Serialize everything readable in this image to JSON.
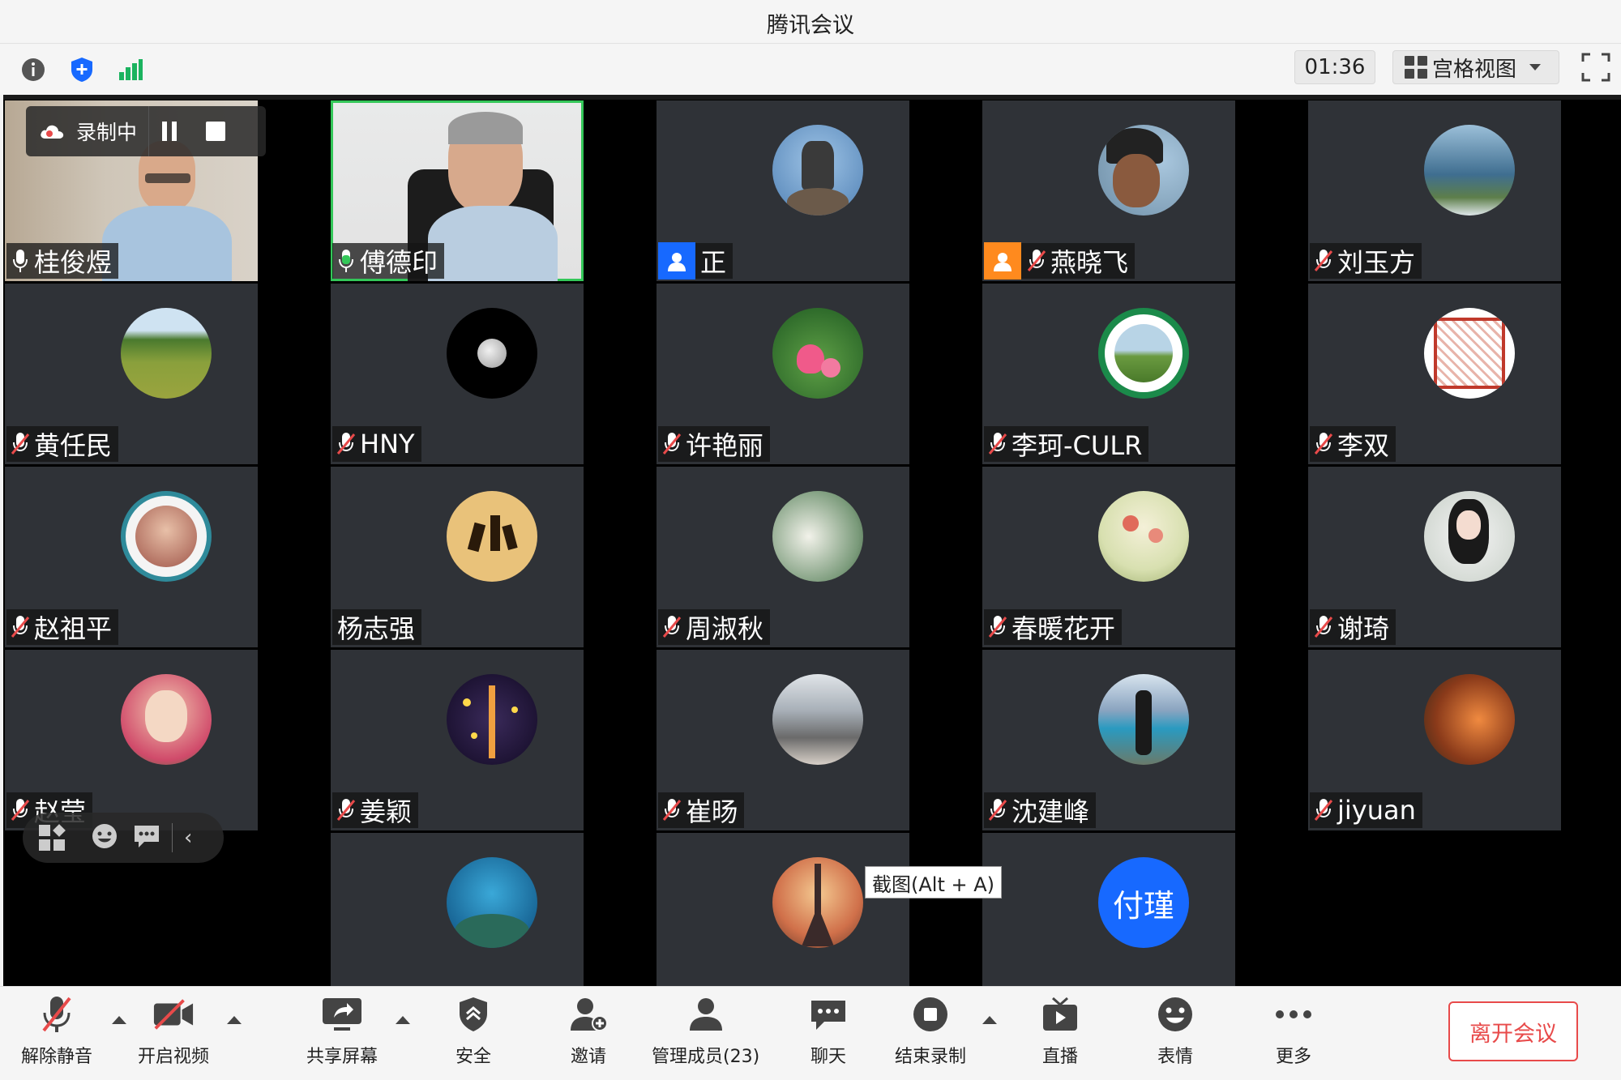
{
  "window": {
    "title": "腾讯会议"
  },
  "topbar": {
    "timer": "01:36",
    "view_mode": "宫格视图"
  },
  "recording": {
    "label": "录制中"
  },
  "tooltip": {
    "text": "截图(Alt + A)"
  },
  "colors": {
    "accent": "#1769ff",
    "speaking": "#34c759",
    "muted": "#e84a4a",
    "tile_bg": "#2f3237"
  },
  "participants": [
    {
      "name": "桂俊煜",
      "mic": "on"
    },
    {
      "name": "傅德印",
      "mic": "speaking"
    },
    {
      "name": "正",
      "mic": "none",
      "avatar_label": ""
    },
    {
      "name": "燕晓飞",
      "mic": "muted"
    },
    {
      "name": "刘玉方",
      "mic": "muted"
    },
    {
      "name": "黄任民",
      "mic": "muted"
    },
    {
      "name": "HNY",
      "mic": "muted"
    },
    {
      "name": "许艳丽",
      "mic": "muted"
    },
    {
      "name": "李珂-CULR",
      "mic": "muted"
    },
    {
      "name": "李双",
      "mic": "muted"
    },
    {
      "name": "赵祖平",
      "mic": "muted"
    },
    {
      "name": "杨志强",
      "mic": "none"
    },
    {
      "name": "周淑秋",
      "mic": "muted"
    },
    {
      "name": "春暖花开",
      "mic": "muted"
    },
    {
      "name": "谢琦",
      "mic": "muted"
    },
    {
      "name": "赵莹",
      "mic": "muted"
    },
    {
      "name": "姜颖",
      "mic": "muted"
    },
    {
      "name": "崔旸",
      "mic": "muted"
    },
    {
      "name": "沈建峰",
      "mic": "muted"
    },
    {
      "name": "jiyuan",
      "mic": "muted"
    },
    {
      "name": "",
      "mic": "none"
    },
    {
      "name": "",
      "mic": "none"
    },
    {
      "name": "",
      "mic": "none",
      "avatar_label": "付瑾"
    }
  ],
  "bottombar": {
    "unmute": "解除静音",
    "start_video": "开启视频",
    "share_screen": "共享屏幕",
    "security": "安全",
    "invite": "邀请",
    "manage_members": "管理成员(23)",
    "chat": "聊天",
    "stop_recording": "结束录制",
    "live": "直播",
    "reactions": "表情",
    "more": "更多",
    "leave": "离开会议"
  }
}
